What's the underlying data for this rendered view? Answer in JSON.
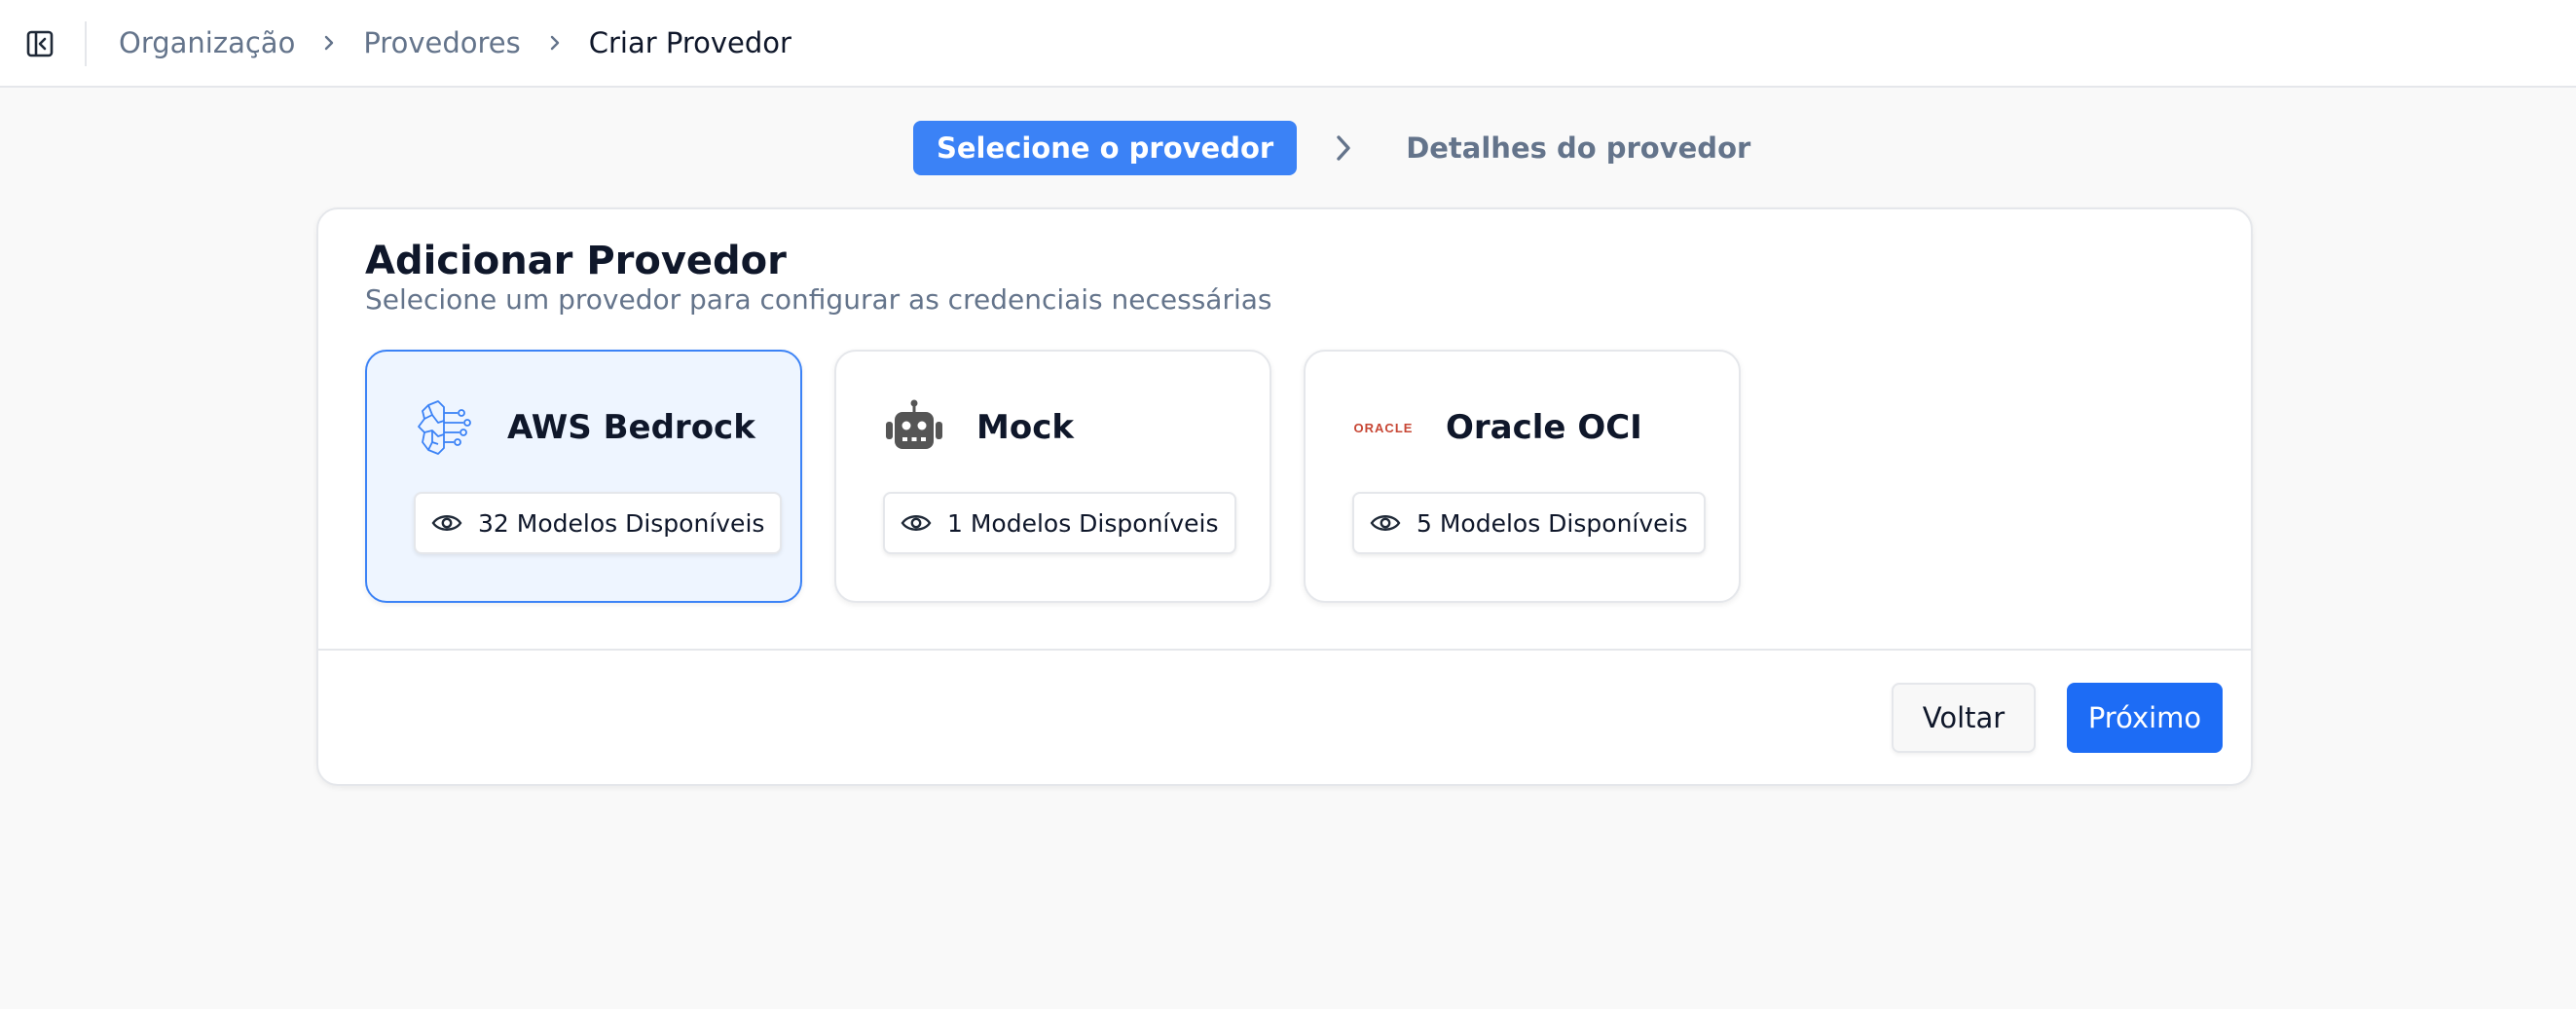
{
  "breadcrumb": {
    "items": [
      "Organização",
      "Provedores"
    ],
    "current": "Criar Provedor"
  },
  "stepper": {
    "step1": "Selecione o provedor",
    "step2": "Detalhes do provedor"
  },
  "card": {
    "title": "Adicionar Provedor",
    "subtitle": "Selecione um provedor para configurar as credenciais necessárias"
  },
  "providers": [
    {
      "name": "AWS Bedrock",
      "models": "32 Modelos Disponíveis",
      "icon": "aws-bedrock-icon",
      "selected": true
    },
    {
      "name": "Mock",
      "models": "1 Modelos Disponíveis",
      "icon": "robot-icon",
      "selected": false
    },
    {
      "name": "Oracle OCI",
      "models": "5 Modelos Disponíveis",
      "icon": "oracle-logo",
      "selected": false,
      "logo_text": "ORACLE"
    }
  ],
  "footer": {
    "back_label": "Voltar",
    "next_label": "Próximo"
  },
  "colors": {
    "accent": "#3b82f6",
    "primary_button": "#1d6cf5",
    "selected_bg": "#eef5ff",
    "oracle_red": "#c74634"
  }
}
